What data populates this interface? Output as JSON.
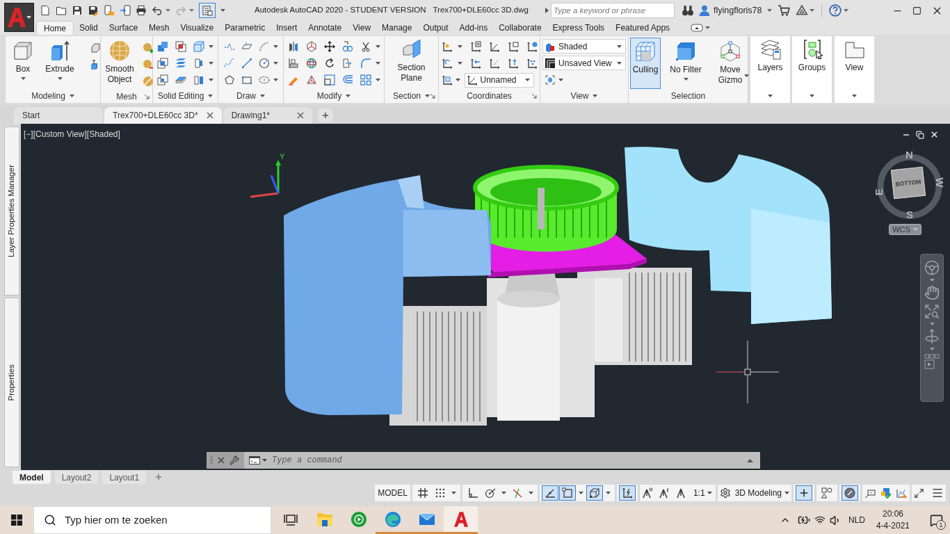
{
  "title_bar": {
    "title": "Autodesk AutoCAD 2020 - STUDENT VERSION",
    "file_name": "Trex700+DLE60cc 3D.dwg",
    "search": {
      "placeholder": "Type a keyword or phrase"
    },
    "user": "flyingfloris78"
  },
  "ribbon_tabs": [
    {
      "label": "Home",
      "selected": true
    },
    {
      "label": "Solid",
      "selected": false
    },
    {
      "label": "Surface",
      "selected": false
    },
    {
      "label": "Mesh",
      "selected": false
    },
    {
      "label": "Visualize",
      "selected": false
    },
    {
      "label": "Parametric",
      "selected": false
    },
    {
      "label": "Insert",
      "selected": false
    },
    {
      "label": "Annotate",
      "selected": false
    },
    {
      "label": "View",
      "selected": false
    },
    {
      "label": "Manage",
      "selected": false
    },
    {
      "label": "Output",
      "selected": false
    },
    {
      "label": "Add-ins",
      "selected": false
    },
    {
      "label": "Collaborate",
      "selected": false
    },
    {
      "label": "Express Tools",
      "selected": false
    },
    {
      "label": "Featured Apps",
      "selected": false
    }
  ],
  "ribbon_panels": [
    {
      "kind": "modeling",
      "title": "Modeling",
      "buttons": [
        "Box",
        "Extrude"
      ]
    },
    {
      "kind": "mesh",
      "title": "Mesh",
      "buttons": [
        "Smooth Object"
      ]
    },
    {
      "kind": "solidedit",
      "title": "Solid Editing"
    },
    {
      "kind": "draw",
      "title": "Draw"
    },
    {
      "kind": "modify",
      "title": "Modify"
    },
    {
      "kind": "section",
      "title": "Section",
      "buttons": [
        "Section Plane"
      ]
    },
    {
      "kind": "coordinates",
      "title": "Coordinates",
      "dropdowns": [
        "Unnamed"
      ]
    },
    {
      "kind": "view",
      "title": "View",
      "dropdowns": [
        "Shaded",
        "Unsaved View"
      ]
    },
    {
      "kind": "selection",
      "title": "Selection",
      "toggles": [
        {
          "label": "Culling",
          "on": true
        },
        {
          "label": "No Filter",
          "on": false
        },
        {
          "label": "Move Gizmo",
          "on": false
        }
      ]
    },
    {
      "kind": "layers",
      "buttons": [
        "Layers"
      ]
    },
    {
      "kind": "groups",
      "buttons": [
        "Groups"
      ]
    },
    {
      "kind": "viewgallery",
      "buttons": [
        "View"
      ]
    }
  ],
  "document_tabs": [
    {
      "label": "Start",
      "selected": false,
      "closable": false
    },
    {
      "label": "Trex700+DLE60cc 3D*",
      "selected": true,
      "closable": true
    },
    {
      "label": "Drawing1*",
      "selected": false,
      "closable": true
    }
  ],
  "palettes": [
    "Layer Properties Manager",
    "Properties"
  ],
  "viewport": {
    "controls": [
      "[−]",
      "[Custom View]",
      "[Shaded]"
    ],
    "axis_label": "Y",
    "view_cube": {
      "face": "BOTTOM",
      "compass": {
        "north": "N",
        "east": "E",
        "south": "S",
        "west": "W"
      },
      "coordinate_system": "WCS"
    }
  },
  "command_line": {
    "placeholder": "Type a command"
  },
  "layout_tabs": [
    {
      "label": "Model",
      "selected": true
    },
    {
      "label": "Layout2",
      "selected": false
    },
    {
      "label": "Layout1",
      "selected": false
    }
  ],
  "status_bar": {
    "space": "MODEL",
    "toggles": [
      {
        "kind": "grid",
        "on": false
      },
      {
        "kind": "snap",
        "on": false
      },
      {
        "kind": "ortho",
        "on": false
      },
      {
        "kind": "polar",
        "on": false
      },
      {
        "kind": "isodraft",
        "on": false
      },
      {
        "kind": "otrack",
        "on": true
      },
      {
        "kind": "osnap",
        "on": true
      },
      {
        "kind": "osnap3d",
        "on": true
      },
      {
        "kind": "ducs",
        "on": true
      },
      {
        "kind": "annomonitor",
        "on": true
      },
      {
        "kind": "isolate",
        "on": false
      },
      {
        "kind": "graphics",
        "on": true
      }
    ],
    "scale": "1:1",
    "workspace": "3D Modeling"
  },
  "taskbar": {
    "search": {
      "placeholder": "Typ hier om te zoeken"
    },
    "apps": [
      {
        "kind": "taskview",
        "running": false,
        "selected": false
      },
      {
        "kind": "explorer",
        "running": false,
        "selected": false
      },
      {
        "kind": "media",
        "running": false,
        "selected": false
      },
      {
        "kind": "edge",
        "running": true,
        "selected": false
      },
      {
        "kind": "mail",
        "running": true,
        "selected": false
      },
      {
        "kind": "autocad",
        "running": true,
        "selected": true
      }
    ],
    "language": "NLD",
    "time": "20:06",
    "date": "4-4-2021",
    "notifications": "1"
  }
}
